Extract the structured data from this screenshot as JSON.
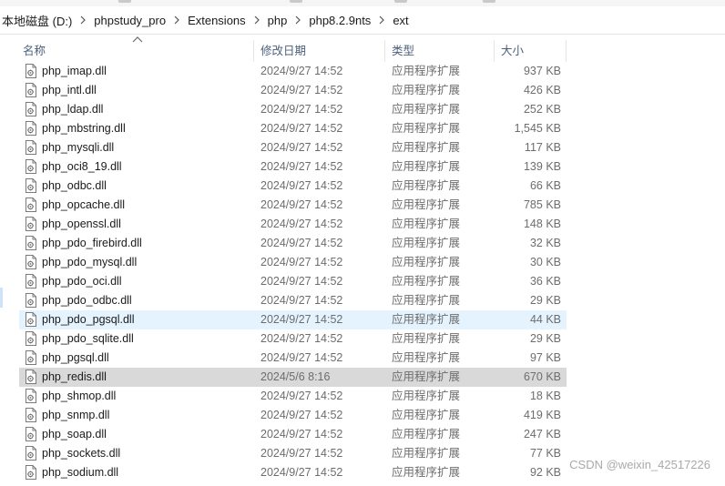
{
  "breadcrumb": [
    "本地磁盘 (D:)",
    "phpstudy_pro",
    "Extensions",
    "php",
    "php8.2.9nts",
    "ext"
  ],
  "columns": {
    "name": "名称",
    "date": "修改日期",
    "type": "类型",
    "size": "大小"
  },
  "files": [
    {
      "name": "php_imap.dll",
      "date": "2024/9/27 14:52",
      "type": "应用程序扩展",
      "size": "937 KB"
    },
    {
      "name": "php_intl.dll",
      "date": "2024/9/27 14:52",
      "type": "应用程序扩展",
      "size": "426 KB"
    },
    {
      "name": "php_ldap.dll",
      "date": "2024/9/27 14:52",
      "type": "应用程序扩展",
      "size": "252 KB"
    },
    {
      "name": "php_mbstring.dll",
      "date": "2024/9/27 14:52",
      "type": "应用程序扩展",
      "size": "1,545 KB"
    },
    {
      "name": "php_mysqli.dll",
      "date": "2024/9/27 14:52",
      "type": "应用程序扩展",
      "size": "117 KB"
    },
    {
      "name": "php_oci8_19.dll",
      "date": "2024/9/27 14:52",
      "type": "应用程序扩展",
      "size": "139 KB"
    },
    {
      "name": "php_odbc.dll",
      "date": "2024/9/27 14:52",
      "type": "应用程序扩展",
      "size": "66 KB"
    },
    {
      "name": "php_opcache.dll",
      "date": "2024/9/27 14:52",
      "type": "应用程序扩展",
      "size": "785 KB"
    },
    {
      "name": "php_openssl.dll",
      "date": "2024/9/27 14:52",
      "type": "应用程序扩展",
      "size": "148 KB"
    },
    {
      "name": "php_pdo_firebird.dll",
      "date": "2024/9/27 14:52",
      "type": "应用程序扩展",
      "size": "32 KB"
    },
    {
      "name": "php_pdo_mysql.dll",
      "date": "2024/9/27 14:52",
      "type": "应用程序扩展",
      "size": "30 KB"
    },
    {
      "name": "php_pdo_oci.dll",
      "date": "2024/9/27 14:52",
      "type": "应用程序扩展",
      "size": "36 KB"
    },
    {
      "name": "php_pdo_odbc.dll",
      "date": "2024/9/27 14:52",
      "type": "应用程序扩展",
      "size": "29 KB"
    },
    {
      "name": "php_pdo_pgsql.dll",
      "date": "2024/9/27 14:52",
      "type": "应用程序扩展",
      "size": "44 KB",
      "state": "hover"
    },
    {
      "name": "php_pdo_sqlite.dll",
      "date": "2024/9/27 14:52",
      "type": "应用程序扩展",
      "size": "29 KB"
    },
    {
      "name": "php_pgsql.dll",
      "date": "2024/9/27 14:52",
      "type": "应用程序扩展",
      "size": "97 KB"
    },
    {
      "name": "php_redis.dll",
      "date": "2024/5/6 8:16",
      "type": "应用程序扩展",
      "size": "670 KB",
      "state": "selected"
    },
    {
      "name": "php_shmop.dll",
      "date": "2024/9/27 14:52",
      "type": "应用程序扩展",
      "size": "18 KB"
    },
    {
      "name": "php_snmp.dll",
      "date": "2024/9/27 14:52",
      "type": "应用程序扩展",
      "size": "419 KB"
    },
    {
      "name": "php_soap.dll",
      "date": "2024/9/27 14:52",
      "type": "应用程序扩展",
      "size": "247 KB"
    },
    {
      "name": "php_sockets.dll",
      "date": "2024/9/27 14:52",
      "type": "应用程序扩展",
      "size": "77 KB"
    },
    {
      "name": "php_sodium.dll",
      "date": "2024/9/27 14:52",
      "type": "应用程序扩展",
      "size": "92 KB"
    }
  ],
  "file_icon": "dll-file-icon",
  "colors": {
    "hover": "#e5f3ff",
    "selected": "#d9d9d9",
    "header_text": "#4c607a",
    "meta_text": "#6d6d6d"
  },
  "watermark": "CSDN @weixin_42517226"
}
